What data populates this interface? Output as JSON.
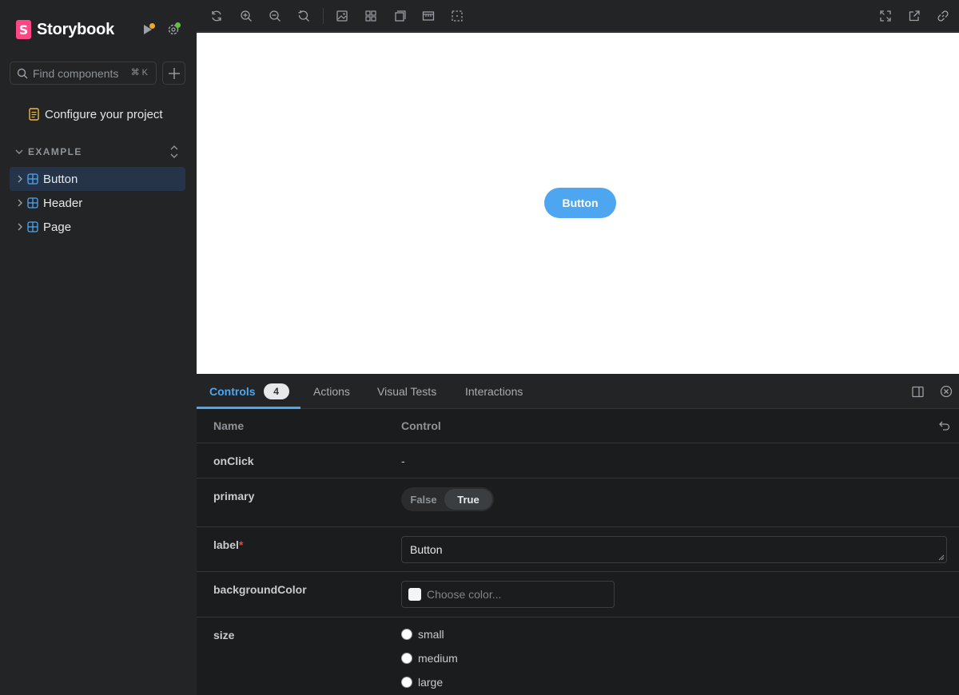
{
  "sidebar": {
    "brand": "Storybook",
    "brand_logo_letter": "S",
    "search": {
      "placeholder": "Find components",
      "shortcut": "⌘ K"
    },
    "configure_label": "Configure your project",
    "group_title": "EXAMPLE",
    "items": [
      {
        "label": "Button",
        "active": true
      },
      {
        "label": "Header",
        "active": false
      },
      {
        "label": "Page",
        "active": false
      }
    ],
    "status_colors": {
      "play_dot": "#f5a623",
      "settings_dot": "#66bf3c"
    }
  },
  "toolbar": {
    "left_icons": [
      "reload-icon",
      "zoom-in-icon",
      "zoom-out-icon",
      "zoom-reset-icon",
      "background-icon",
      "grid-icon",
      "viewport-icon",
      "measure-icon",
      "outline-icon"
    ],
    "right_icons": [
      "fullscreen-icon",
      "open-new-tab-icon",
      "copy-link-icon"
    ]
  },
  "canvas": {
    "story_button_label": "Button",
    "story_button_color": "#4ea6f1"
  },
  "panel": {
    "tabs": [
      {
        "label": "Controls",
        "badge": "4",
        "active": true
      },
      {
        "label": "Actions"
      },
      {
        "label": "Visual Tests"
      },
      {
        "label": "Interactions"
      }
    ],
    "table": {
      "headers": {
        "name": "Name",
        "control": "Control"
      },
      "rows": {
        "onClick": {
          "name": "onClick",
          "value": "-"
        },
        "primary": {
          "name": "primary",
          "options": [
            "False",
            "True"
          ],
          "selected": "True"
        },
        "label": {
          "name": "label",
          "required_mark": "*",
          "value": "Button"
        },
        "backgroundColor": {
          "name": "backgroundColor",
          "placeholder": "Choose color..."
        },
        "size": {
          "name": "size",
          "options": [
            "small",
            "medium",
            "large"
          ]
        }
      }
    }
  }
}
